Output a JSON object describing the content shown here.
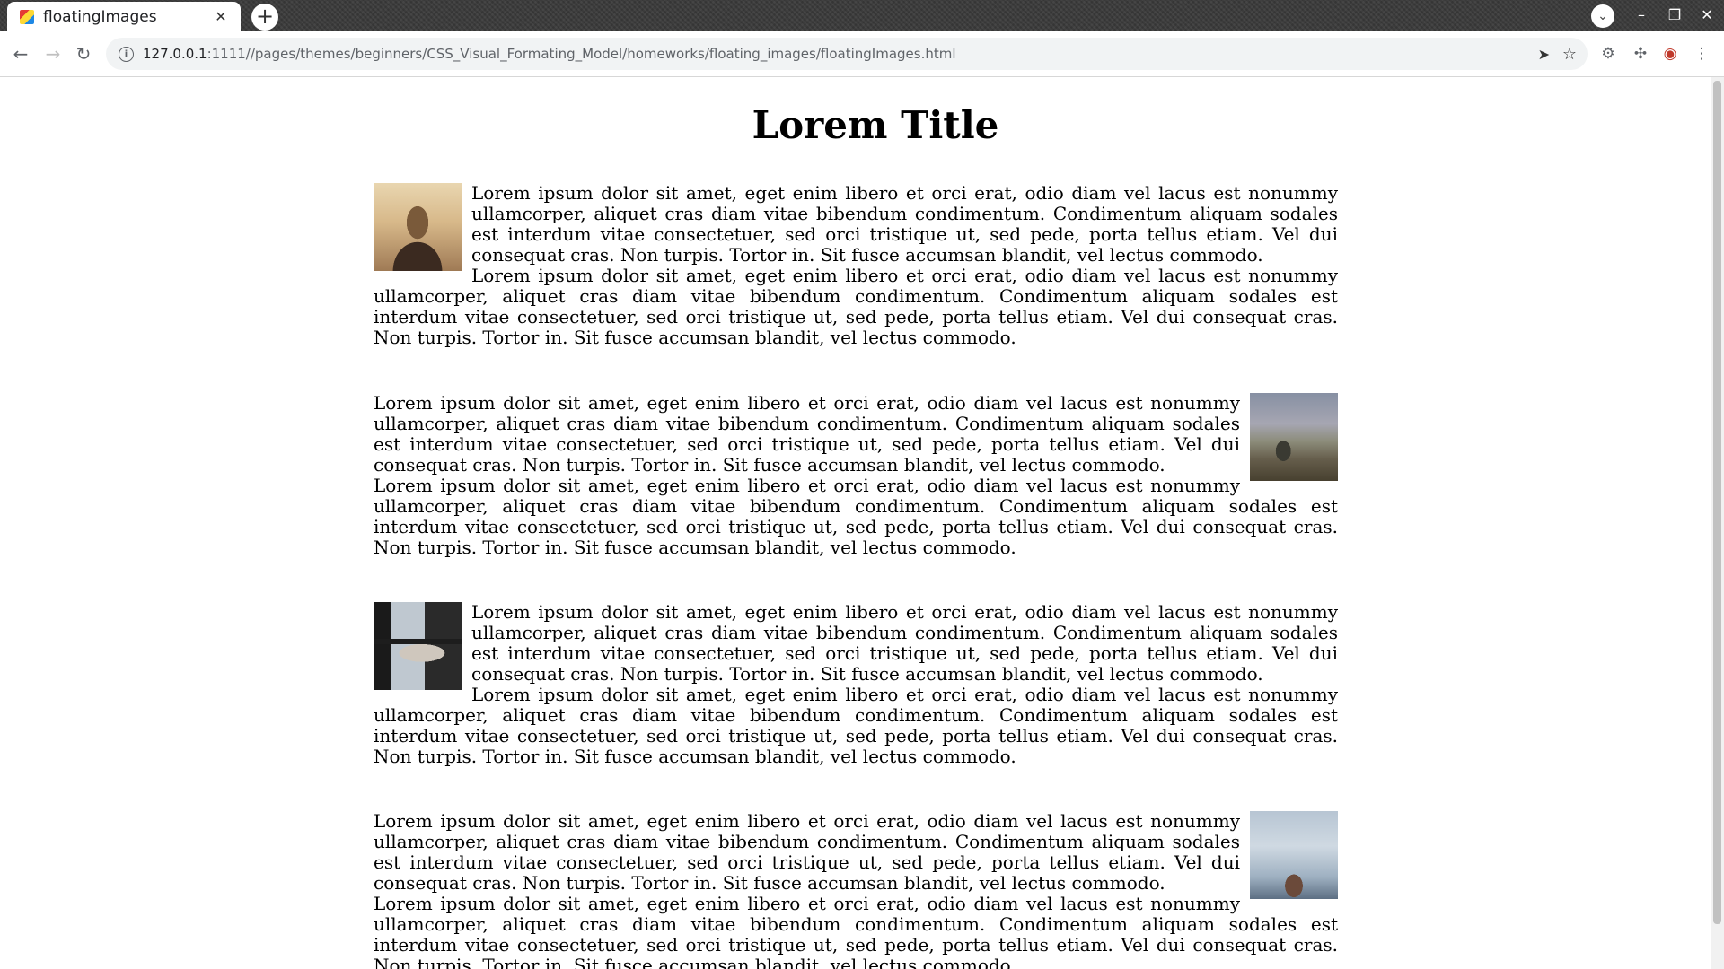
{
  "browser": {
    "tab_title": "floatingImages",
    "tab_close": "✕",
    "new_tab": "+",
    "url_host": "127.0.0.1",
    "url_rest": ":1111//pages/themes/beginners/CSS_Visual_Formating_Model/homeworks/floating_images/floatingImages.html",
    "icons": [
      "favicon",
      "back-icon",
      "forward-icon",
      "reload-icon",
      "info-icon",
      "send-icon",
      "star-icon",
      "extension-icon",
      "puzzle-icon",
      "profile-icon",
      "menu-icon",
      "tab-search-icon",
      "minimize-icon",
      "maximize-icon",
      "close-window-icon"
    ]
  },
  "page": {
    "title": "Lorem Title",
    "sections": [
      {
        "image_side": "left",
        "image_alt": "woman with scarf at sunset",
        "p1": "Lorem ipsum dolor sit amet, eget enim libero et orci erat, odio diam vel lacus est nonummy ullamcorper, aliquet cras diam vitae bibendum condimentum. Condimentum aliquam sodales est interdum vitae consectetuer, sed orci tristique ut, sed pede, porta tellus etiam. Vel dui consequat cras. Non turpis. Tortor in. Sit fusce accumsan blandit, vel lectus commodo.",
        "p2": "Lorem ipsum dolor sit amet, eget enim libero et orci erat, odio diam vel lacus est nonummy ullamcorper, aliquet cras diam vitae bibendum condimentum. Condimentum aliquam sodales est interdum vitae consectetuer, sed orci tristique ut, sed pede, porta tellus etiam. Vel dui consequat cras. Non turpis. Tortor in. Sit fusce accumsan blandit, vel lectus commodo."
      },
      {
        "image_side": "right",
        "image_alt": "person sitting on mountain top",
        "p1": "Lorem ipsum dolor sit amet, eget enim libero et orci erat, odio diam vel lacus est nonummy ullamcorper, aliquet cras diam vitae bibendum condimentum. Condimentum aliquam sodales est interdum vitae consectetuer, sed orci tristique ut, sed pede, porta tellus etiam. Vel dui consequat cras. Non turpis. Tortor in. Sit fusce accumsan blandit, vel lectus commodo.",
        "p2": "Lorem ipsum dolor sit amet, eget enim libero et orci erat, odio diam vel lacus est nonummy ullamcorper, aliquet cras diam vitae bibendum condimentum. Condimentum aliquam sodales est interdum vitae consectetuer, sed orci tristique ut, sed pede, porta tellus etiam. Vel dui consequat cras. Non turpis. Tortor in. Sit fusce accumsan blandit, vel lectus commodo."
      },
      {
        "image_side": "left",
        "image_alt": "person lying on sofa by window",
        "p1": "Lorem ipsum dolor sit amet, eget enim libero et orci erat, odio diam vel lacus est nonummy ullamcorper, aliquet cras diam vitae bibendum condimentum. Condimentum aliquam sodales est interdum vitae consectetuer, sed orci tristique ut, sed pede, porta tellus etiam. Vel dui consequat cras. Non turpis. Tortor in. Sit fusce accumsan blandit, vel lectus commodo.",
        "p2": "Lorem ipsum dolor sit amet, eget enim libero et orci erat, odio diam vel lacus est nonummy ullamcorper, aliquet cras diam vitae bibendum condimentum. Condimentum aliquam sodales est interdum vitae consectetuer, sed orci tristique ut, sed pede, porta tellus etiam. Vel dui consequat cras. Non turpis. Tortor in. Sit fusce accumsan blandit, vel lectus commodo."
      },
      {
        "image_side": "right",
        "image_alt": "man looking at cloudy sky",
        "p1": "Lorem ipsum dolor sit amet, eget enim libero et orci erat, odio diam vel lacus est nonummy ullamcorper, aliquet cras diam vitae bibendum condimentum. Condimentum aliquam sodales est interdum vitae consectetuer, sed orci tristique ut, sed pede, porta tellus etiam. Vel dui consequat cras. Non turpis. Tortor in. Sit fusce accumsan blandit, vel lectus commodo.",
        "p2": "Lorem ipsum dolor sit amet, eget enim libero et orci erat, odio diam vel lacus est nonummy ullamcorper, aliquet cras diam vitae bibendum condimentum. Condimentum aliquam sodales est interdum vitae consectetuer, sed orci tristique ut, sed pede, porta tellus etiam. Vel dui consequat cras. Non turpis. Tortor in. Sit fusce accumsan blandit, vel lectus commodo."
      }
    ]
  }
}
